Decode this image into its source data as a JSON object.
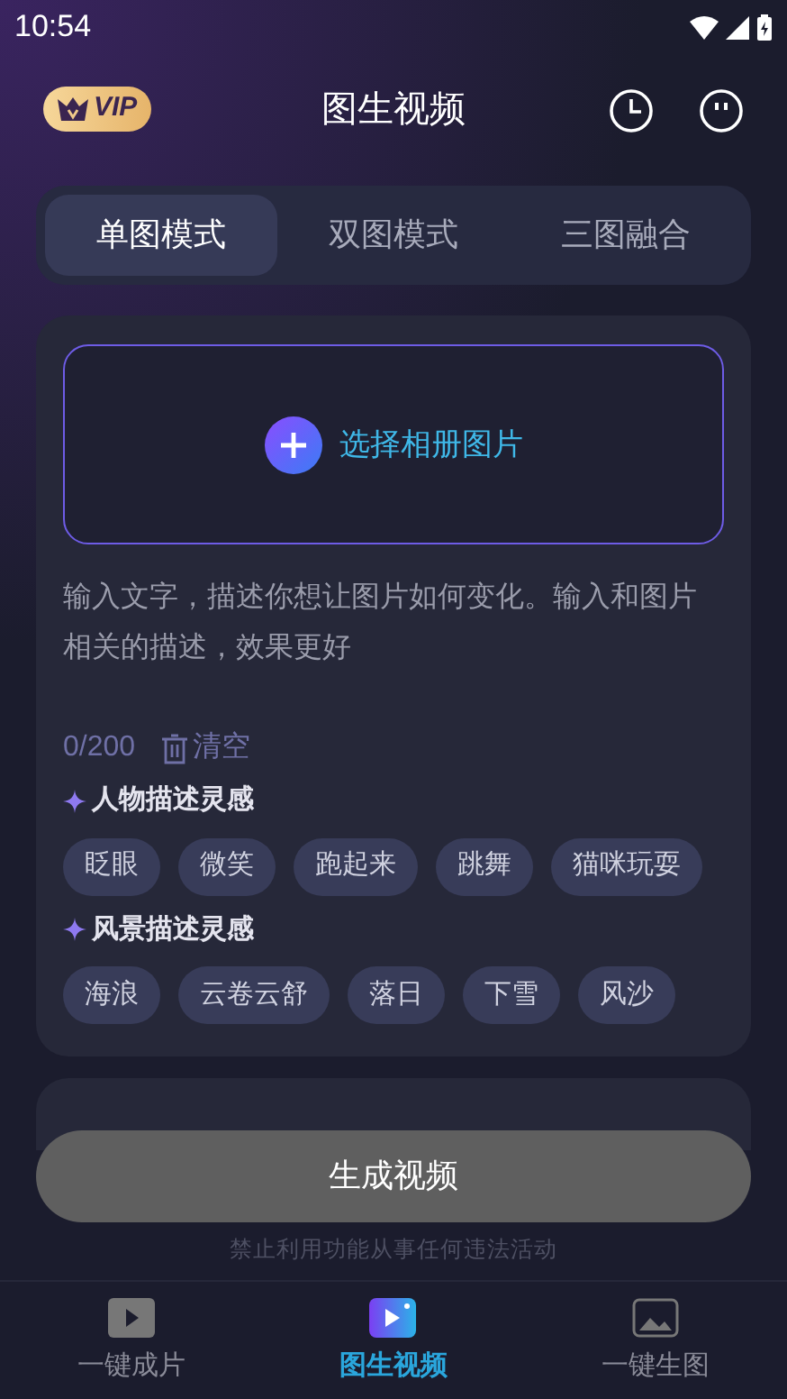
{
  "status_bar": {
    "time": "10:54"
  },
  "header": {
    "vip_badge": "VIP",
    "title": "图生视频"
  },
  "tabs": [
    {
      "label": "单图模式",
      "selected": true
    },
    {
      "label": "双图模式",
      "selected": false
    },
    {
      "label": "三图融合",
      "selected": false
    }
  ],
  "upload": {
    "label": "选择相册图片"
  },
  "prompt": {
    "placeholder": "输入文字，描述你想让图片如何变化。输入和图片相关的描述，效果更好",
    "counter": "0/200",
    "clear": "清空"
  },
  "inspiration_groups": [
    {
      "title": "人物描述灵感",
      "chips": [
        "眨眼",
        "微笑",
        "跑起来",
        "跳舞",
        "猫咪玩耍"
      ]
    },
    {
      "title": "风景描述灵感",
      "chips": [
        "海浪",
        "云卷云舒",
        "落日",
        "下雪",
        "风沙"
      ]
    }
  ],
  "generate_button": "生成视频",
  "disclaimer": "禁止利用功能从事任何违法活动",
  "bottom_nav": [
    {
      "label": "一键成片",
      "selected": false
    },
    {
      "label": "图生视频",
      "selected": true
    },
    {
      "label": "一键生图",
      "selected": false
    }
  ]
}
